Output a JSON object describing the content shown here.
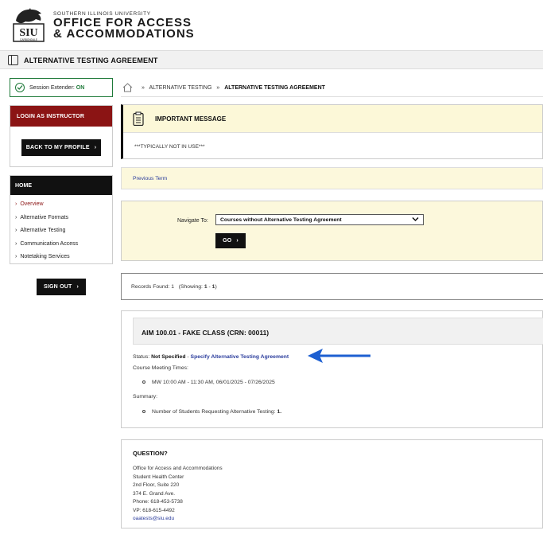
{
  "header": {
    "university": "SOUTHERN ILLINOIS UNIVERSITY",
    "office_line1": "OFFICE FOR ACCESS",
    "office_line2": "& ACCOMMODATIONS",
    "logo_text": "SIU",
    "logo_subtext": "CARBONDALE"
  },
  "titlebar": {
    "title": "ALTERNATIVE TESTING AGREEMENT"
  },
  "session": {
    "label": "Session Extender:",
    "state": "ON"
  },
  "login_box": {
    "header": "LOGIN AS INSTRUCTOR",
    "button": "BACK TO MY PROFILE"
  },
  "nav": {
    "header": "HOME",
    "items": [
      {
        "label": "Overview",
        "active": true
      },
      {
        "label": "Alternative Formats",
        "active": false
      },
      {
        "label": "Alternative Testing",
        "active": false
      },
      {
        "label": "Communication Access",
        "active": false
      },
      {
        "label": "Notetaking Services",
        "active": false
      }
    ]
  },
  "signout": {
    "label": "SIGN OUT"
  },
  "breadcrumb": {
    "items": [
      "ALTERNATIVE TESTING",
      "ALTERNATIVE TESTING AGREEMENT"
    ]
  },
  "message": {
    "title": "IMPORTANT MESSAGE",
    "body": "***TYPICALLY NOT IN USE***"
  },
  "previous_term": {
    "label": "Previous Term"
  },
  "navigate": {
    "label": "Navigate To:",
    "selected": "Courses without Alternative Testing Agreement",
    "go": "GO"
  },
  "records": {
    "prefix": "Records Found: 1",
    "showing_prefix": "(Showing: ",
    "from": "1",
    "dash": " - ",
    "to": "1",
    "suffix": ")"
  },
  "course": {
    "title": "AIM 100.01 - FAKE CLASS (CRN: 00011)",
    "status_label": "Status:",
    "status_value": "Not Specified",
    "status_sep": " - ",
    "status_link": "Specify Alternative Testing Agreement",
    "meeting_label": "Course Meeting Times:",
    "meeting_time": "MW 10:00 AM - 11:30 AM, 06/01/2025 - 07/26/2025",
    "summary_label": "Summary:",
    "requesting_label": "Number of Students Requesting Alternative Testing:",
    "requesting_count": "1."
  },
  "question": {
    "title": "QUESTION?",
    "lines": [
      "Office for Access and Accommodations",
      "Student Health Center",
      "2nd Floor, Suite 220",
      "374 E. Grand Ave.",
      "Phone: 618-453-5738",
      "VP: 618-615-4492"
    ],
    "email": "oaatests@siu.edu"
  },
  "colors": {
    "maroon": "#8b1414",
    "link": "#2a3c9c",
    "green": "#1f7a3a",
    "annotation_arrow": "#1d5fd1",
    "panel_yellow": "#fcf8dc"
  }
}
